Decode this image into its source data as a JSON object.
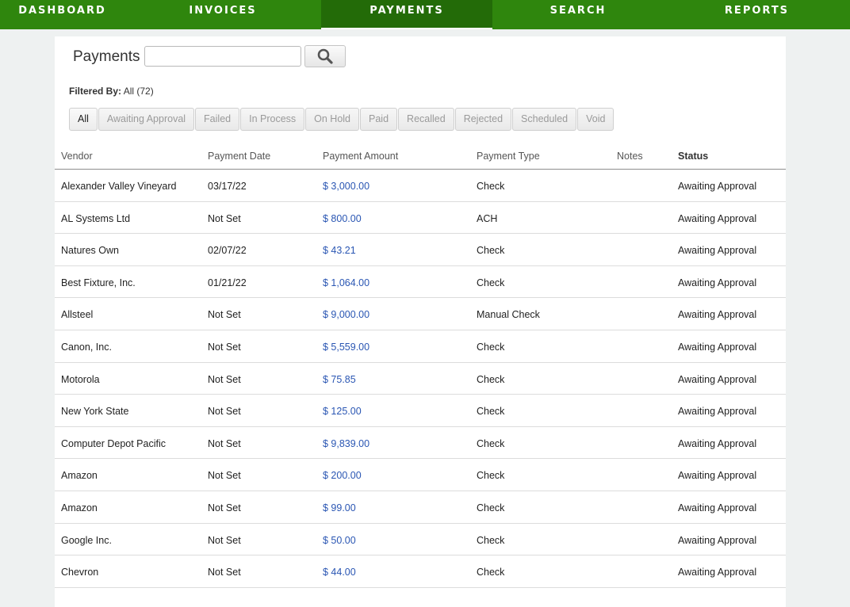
{
  "nav": [
    {
      "label": "DASHBOARD",
      "active": false
    },
    {
      "label": "INVOICES",
      "active": false
    },
    {
      "label": "PAYMENTS",
      "active": true
    },
    {
      "label": "SEARCH",
      "active": false
    },
    {
      "label": "REPORTS",
      "active": false
    }
  ],
  "page": {
    "title": "Payments",
    "search_value": "",
    "search_icon": "magnifier-icon",
    "filtered_by_label": "Filtered By:",
    "filtered_by_value": "All (72)"
  },
  "filters": [
    {
      "label": "All",
      "active": true
    },
    {
      "label": "Awaiting Approval",
      "active": false
    },
    {
      "label": "Failed",
      "active": false
    },
    {
      "label": "In Process",
      "active": false
    },
    {
      "label": "On Hold",
      "active": false
    },
    {
      "label": "Paid",
      "active": false
    },
    {
      "label": "Recalled",
      "active": false
    },
    {
      "label": "Rejected",
      "active": false
    },
    {
      "label": "Scheduled",
      "active": false
    },
    {
      "label": "Void",
      "active": false
    }
  ],
  "table": {
    "headers": {
      "vendor": "Vendor",
      "date": "Payment Date",
      "amount": "Payment Amount",
      "type": "Payment Type",
      "notes": "Notes",
      "status": "Status"
    },
    "rows": [
      {
        "vendor": "Alexander Valley Vineyard",
        "date": "03/17/22",
        "amount": "$ 3,000.00",
        "type": "Check",
        "notes": "",
        "status": "Awaiting Approval"
      },
      {
        "vendor": "AL Systems Ltd",
        "date": "Not Set",
        "amount": "$ 800.00",
        "type": "ACH",
        "notes": "",
        "status": "Awaiting Approval"
      },
      {
        "vendor": "Natures Own",
        "date": "02/07/22",
        "amount": "$ 43.21",
        "type": "Check",
        "notes": "",
        "status": "Awaiting Approval"
      },
      {
        "vendor": "Best Fixture, Inc.",
        "date": "01/21/22",
        "amount": "$ 1,064.00",
        "type": "Check",
        "notes": "",
        "status": "Awaiting Approval"
      },
      {
        "vendor": "Allsteel",
        "date": "Not Set",
        "amount": "$ 9,000.00",
        "type": "Manual Check",
        "notes": "",
        "status": "Awaiting Approval"
      },
      {
        "vendor": "Canon, Inc.",
        "date": "Not Set",
        "amount": "$ 5,559.00",
        "type": "Check",
        "notes": "",
        "status": "Awaiting Approval"
      },
      {
        "vendor": "Motorola",
        "date": "Not Set",
        "amount": "$ 75.85",
        "type": "Check",
        "notes": "",
        "status": "Awaiting Approval"
      },
      {
        "vendor": "New York State",
        "date": "Not Set",
        "amount": "$ 125.00",
        "type": "Check",
        "notes": "",
        "status": "Awaiting Approval"
      },
      {
        "vendor": "Computer Depot Pacific",
        "date": "Not Set",
        "amount": "$ 9,839.00",
        "type": "Check",
        "notes": "",
        "status": "Awaiting Approval"
      },
      {
        "vendor": "Amazon",
        "date": "Not Set",
        "amount": "$ 200.00",
        "type": "Check",
        "notes": "",
        "status": "Awaiting Approval"
      },
      {
        "vendor": "Amazon",
        "date": "Not Set",
        "amount": "$ 99.00",
        "type": "Check",
        "notes": "",
        "status": "Awaiting Approval"
      },
      {
        "vendor": "Google Inc.",
        "date": "Not Set",
        "amount": "$ 50.00",
        "type": "Check",
        "notes": "",
        "status": "Awaiting Approval"
      },
      {
        "vendor": "Chevron",
        "date": "Not Set",
        "amount": "$ 44.00",
        "type": "Check",
        "notes": "",
        "status": "Awaiting Approval"
      }
    ]
  },
  "colors": {
    "nav_bg": "#2f860d",
    "nav_active_bg": "#236b08",
    "link": "#2a56b3",
    "page_bg": "#eef1f1"
  }
}
